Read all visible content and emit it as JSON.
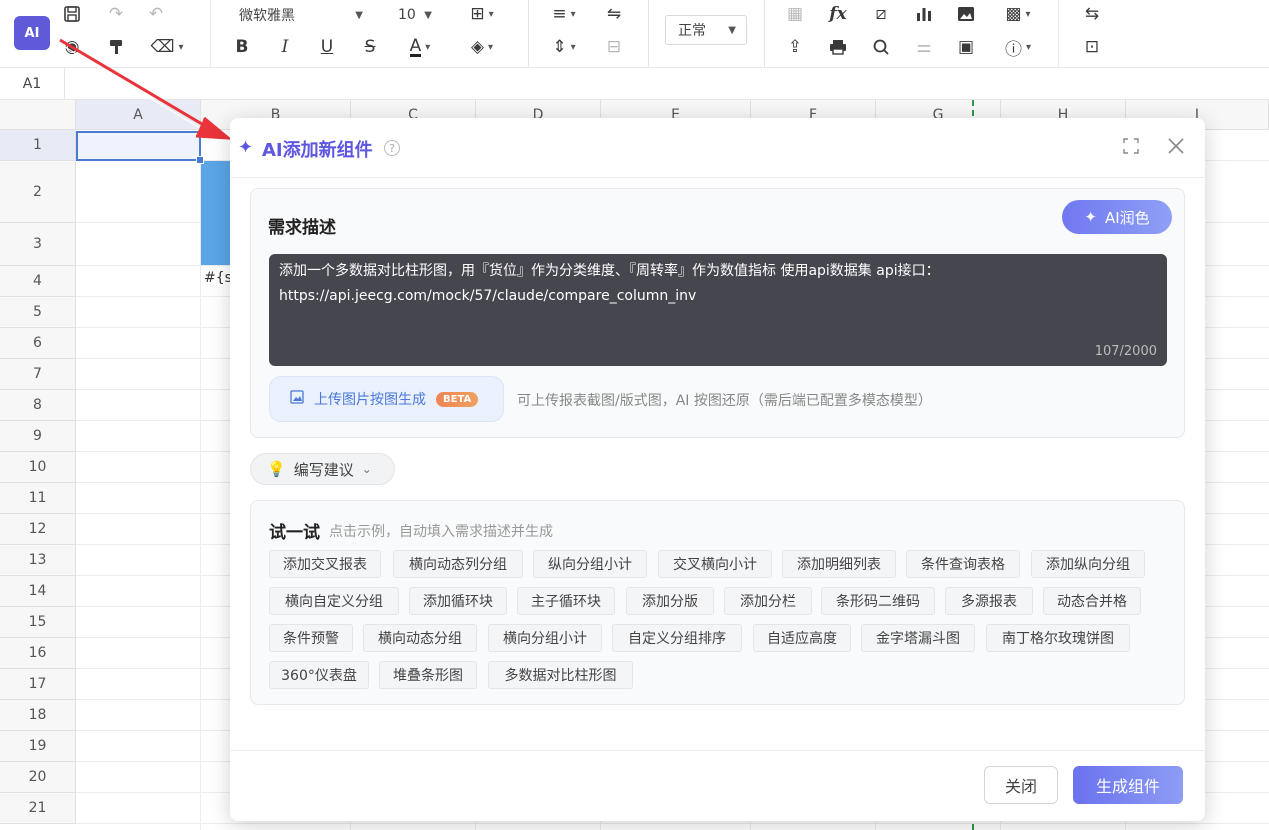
{
  "toolbar": {
    "ai_logo": "AI",
    "font_name": "微软雅黑",
    "font_size": "10",
    "style_select": "正常",
    "bold": "B",
    "italic": "I",
    "underline": "U",
    "strike": "S",
    "font_color": "A",
    "fx": "fx"
  },
  "formula_bar": {
    "cell_ref": "A1"
  },
  "sheet": {
    "columns": [
      "A",
      "B",
      "C",
      "D",
      "E",
      "F",
      "G",
      "H",
      "I"
    ],
    "rows": [
      "1",
      "2",
      "3",
      "4",
      "5",
      "6",
      "7",
      "8",
      "9",
      "10",
      "11",
      "12",
      "13",
      "14",
      "15",
      "16",
      "17",
      "18",
      "19",
      "20",
      "21"
    ],
    "cell_b4_text": "#{s"
  },
  "dialog": {
    "title": "AI添加新组件",
    "help_icon": "?",
    "requirement": {
      "title": "需求描述",
      "ai_polish_label": "AI润色",
      "text": "添加一个多数据对比柱形图，用『货位』作为分类维度、『周转率』作为数值指标 使用api数据集 api接口：https://api.jeecg.com/mock/57/claude/compare_column_inv",
      "counter": "107/2000"
    },
    "upload": {
      "label": "上传图片按图生成",
      "badge": "BETA",
      "hint": "可上传报表截图/版式图，AI 按图还原（需后端已配置多模态模型）"
    },
    "suggest_label": "编写建议",
    "try": {
      "title": "试一试",
      "hint": "点击示例，自动填入需求描述并生成",
      "tags": [
        "添加交叉报表",
        "横向动态列分组",
        "纵向分组小计",
        "交叉横向小计",
        "添加明细列表",
        "条件查询表格",
        "添加纵向分组",
        "横向自定义分组",
        "添加循环块",
        "主子循环块",
        "添加分版",
        "添加分栏",
        "条形码二维码",
        "多源报表",
        "动态合并格",
        "条件预警",
        "横向动态分组",
        "横向分组小计",
        "自定义分组排序",
        "自适应高度",
        "金字塔漏斗图",
        "南丁格尔玫瑰饼图",
        "360°仪表盘",
        "堆叠条形图",
        "多数据对比柱形图"
      ]
    },
    "close_label": "关闭",
    "generate_label": "生成组件"
  }
}
